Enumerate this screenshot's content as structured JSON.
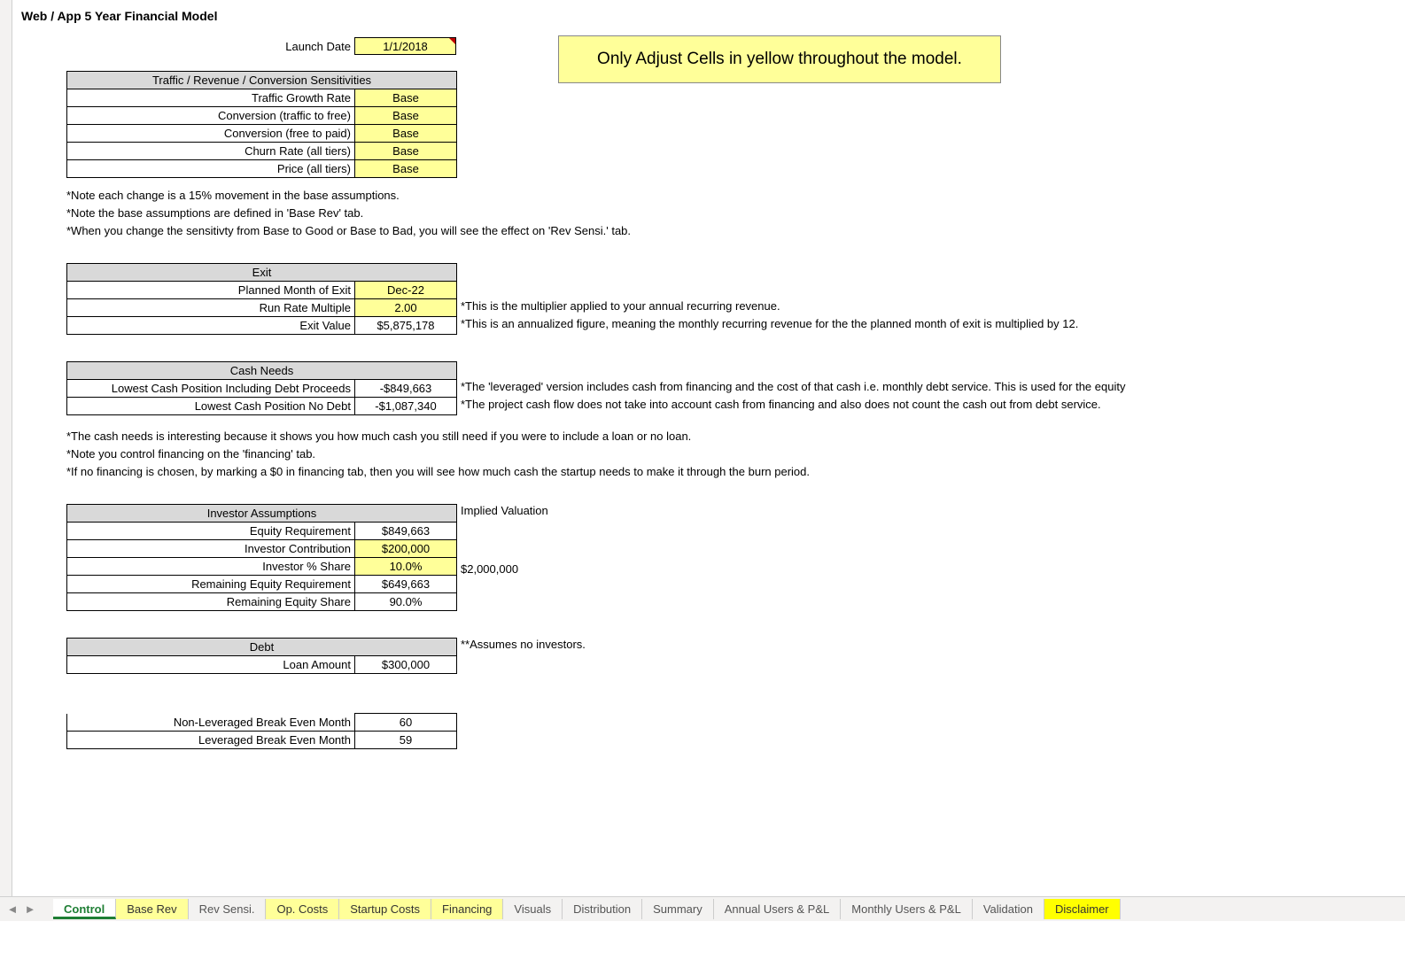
{
  "title": "Web / App 5 Year Financial Model",
  "launch": {
    "label": "Launch Date",
    "value": "1/1/2018"
  },
  "note_box": "Only Adjust Cells in yellow throughout the model.",
  "sensitivities": {
    "header": "Traffic / Revenue / Conversion Sensitivities",
    "rows": [
      {
        "label": "Traffic Growth Rate",
        "value": "Base"
      },
      {
        "label": "Conversion (traffic to free)",
        "value": "Base"
      },
      {
        "label": "Conversion (free to paid)",
        "value": "Base"
      },
      {
        "label": "Churn Rate (all tiers)",
        "value": "Base"
      },
      {
        "label": "Price (all tiers)",
        "value": "Base"
      }
    ]
  },
  "sens_notes": [
    "*Note each change is a 15% movement in the base assumptions.",
    "*Note the base assumptions are defined in 'Base Rev' tab.",
    "*When you change the sensitivty from Base to Good or Base to Bad, you will see the effect on 'Rev Sensi.' tab."
  ],
  "exit": {
    "header": "Exit",
    "rows": [
      {
        "label": "Planned Month of Exit",
        "value": "Dec-22",
        "yellow": true,
        "note": ""
      },
      {
        "label": "Run Rate Multiple",
        "value": "2.00",
        "yellow": true,
        "note": "*This is the multiplier applied to your annual recurring revenue."
      },
      {
        "label": "Exit Value",
        "value": "$5,875,178",
        "yellow": false,
        "note": "*This is an annualized figure, meaning the monthly recurring revenue for the the planned month of exit is multiplied by 12."
      }
    ]
  },
  "cash": {
    "header": "Cash Needs",
    "rows": [
      {
        "label": "Lowest Cash Position Including Debt Proceeds",
        "value": "-$849,663",
        "note": "*The 'leveraged' version includes cash from financing and the cost of that cash i.e. monthly debt service. This is used for the equity"
      },
      {
        "label": "Lowest Cash Position No Debt",
        "value": "-$1,087,340",
        "note": "*The project cash flow does not take into account cash from financing and also does not count the cash out from debt service."
      }
    ]
  },
  "cash_notes": [
    "*The cash needs is interesting because it shows you how much cash you still need if you were to include a loan or no loan.",
    "*Note you control financing on the 'financing' tab.",
    "*If no financing is chosen, by marking a $0 in financing tab, then you will see how much cash the startup needs to make it through the burn period."
  ],
  "investor": {
    "header": "Investor Assumptions",
    "side_header": "Implied Valuation",
    "rows": [
      {
        "label": "Equity Requirement",
        "value": "$849,663",
        "yellow": false,
        "note": ""
      },
      {
        "label": "Investor Contribution",
        "value": "$200,000",
        "yellow": true,
        "note": ""
      },
      {
        "label": "Investor % Share",
        "value": "10.0%",
        "yellow": true,
        "note": "$2,000,000"
      },
      {
        "label": "Remaining Equity Requirement",
        "value": "$649,663",
        "yellow": false,
        "note": ""
      },
      {
        "label": "Remaining Equity Share",
        "value": "90.0%",
        "yellow": false,
        "note": ""
      }
    ]
  },
  "debt": {
    "header": "Debt",
    "side_note": "**Assumes no investors.",
    "rows": [
      {
        "label": "Loan Amount",
        "value": "$300,000"
      }
    ]
  },
  "breakeven": {
    "rows": [
      {
        "label": "Non-Leveraged Break Even Month",
        "value": "60"
      },
      {
        "label": "Leveraged Break Even Month",
        "value": "59"
      }
    ]
  },
  "tabs": [
    {
      "label": "Control",
      "style": "active"
    },
    {
      "label": "Base Rev",
      "style": "ylw"
    },
    {
      "label": "Rev Sensi.",
      "style": ""
    },
    {
      "label": "Op. Costs",
      "style": "ylw"
    },
    {
      "label": "Startup Costs",
      "style": "ylw"
    },
    {
      "label": "Financing",
      "style": "ylw"
    },
    {
      "label": "Visuals",
      "style": ""
    },
    {
      "label": "Distribution",
      "style": ""
    },
    {
      "label": "Summary",
      "style": ""
    },
    {
      "label": "Annual Users & P&L",
      "style": ""
    },
    {
      "label": "Monthly Users & P&L",
      "style": ""
    },
    {
      "label": "Validation",
      "style": ""
    },
    {
      "label": "Disclaimer",
      "style": "bright"
    }
  ],
  "nav": {
    "prev": "◄",
    "next": "►"
  }
}
